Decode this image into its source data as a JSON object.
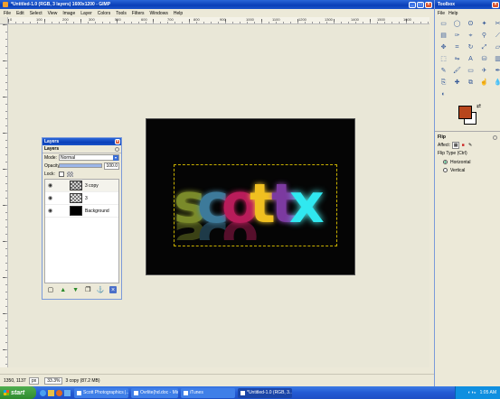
{
  "gimp_window": {
    "title": "*Untitled-1.0 (RGB, 3 layers) 1600x1200 - GIMP",
    "menu": [
      "File",
      "Edit",
      "Select",
      "View",
      "Image",
      "Layer",
      "Colors",
      "Tools",
      "Filters",
      "Windows",
      "Help"
    ],
    "ruler_ticks": [
      "0",
      "100",
      "200",
      "300",
      "500",
      "600",
      "700",
      "800",
      "900",
      "1000",
      "1100",
      "1200",
      "1300",
      "1400",
      "1500",
      "1600"
    ],
    "canvas_text": "scottx",
    "status": {
      "coords": "1350, 1137",
      "unit": "px",
      "zoom": "33.3%",
      "layer_info": "3 copy (87.2 MB)"
    }
  },
  "layers_dialog": {
    "title": "Layers",
    "section": "Layers",
    "mode_label": "Mode:",
    "mode_value": "Normal",
    "opacity_label": "Opacity:",
    "opacity_value": "100.0",
    "lock_label": "Lock:",
    "layers": [
      {
        "name": "3 copy"
      },
      {
        "name": "3"
      },
      {
        "name": "Background"
      }
    ]
  },
  "toolbox": {
    "title": "Toolbox",
    "tool_options_title": "Flip",
    "affect_label": "Affect:",
    "flip_type_label": "Flip Type  (Ctrl)",
    "options": [
      {
        "label": "Horizontal",
        "selected": true
      },
      {
        "label": "Vertical",
        "selected": false
      }
    ],
    "fg_color": "#b8461c",
    "bg_color": "#ffffff"
  },
  "taskbar": {
    "start": "start",
    "tasks": [
      "Scott Photographics |...",
      "Ovrlite(hd.doc - Micr...",
      "iTunes",
      "*Untitled-1.0 (RGB, 3..."
    ],
    "clock": "1:05 AM"
  }
}
